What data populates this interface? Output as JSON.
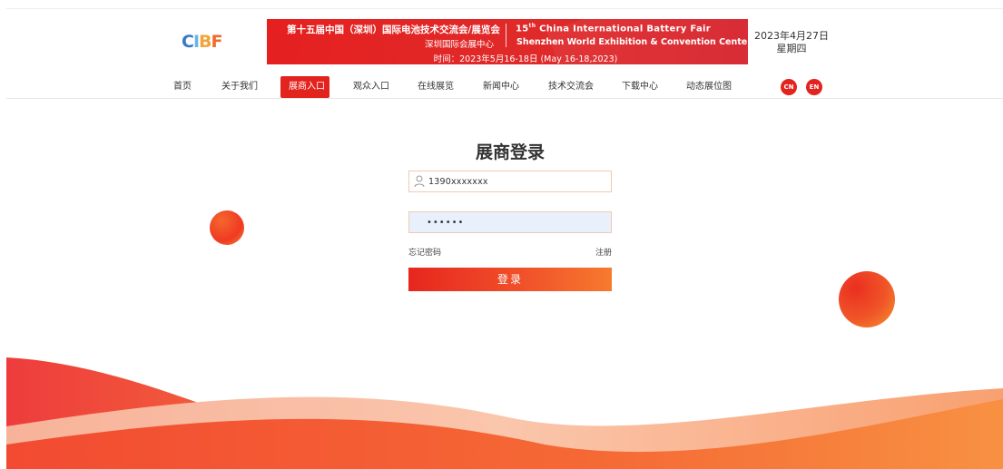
{
  "header": {
    "logo_text": "CIBF",
    "banner": {
      "cn_title": "第十五届中国（深圳）国际电池技术交流会/展览会",
      "cn_venue": "深圳国际会展中心",
      "en_title_prefix": "15",
      "en_title_sup": "th",
      "en_title_rest": " China International Battery Fair",
      "en_venue": "Shenzhen World Exhibition & Convention Center",
      "dates": "时间：2023年5月16-18日  (May 16-18,2023)"
    },
    "date": "2023年4月27日",
    "weekday": "星期四"
  },
  "nav": {
    "items": [
      {
        "label": "首页"
      },
      {
        "label": "关于我们"
      },
      {
        "label": "展商入口",
        "active": true
      },
      {
        "label": "观众入口"
      },
      {
        "label": "在线展览"
      },
      {
        "label": "新闻中心"
      },
      {
        "label": "技术交流会"
      },
      {
        "label": "下载中心"
      },
      {
        "label": "动态展位图"
      }
    ],
    "lang_cn": "CN",
    "lang_en": "EN"
  },
  "login": {
    "title": "展商登录",
    "username_value": "1390xxxxxxx",
    "password_mask": "••••••",
    "forgot_label": "忘记密码",
    "register_label": "注册",
    "submit_label": "登录"
  },
  "colors": {
    "accent": "#e3231d",
    "gradient_end": "#f67a2e"
  }
}
